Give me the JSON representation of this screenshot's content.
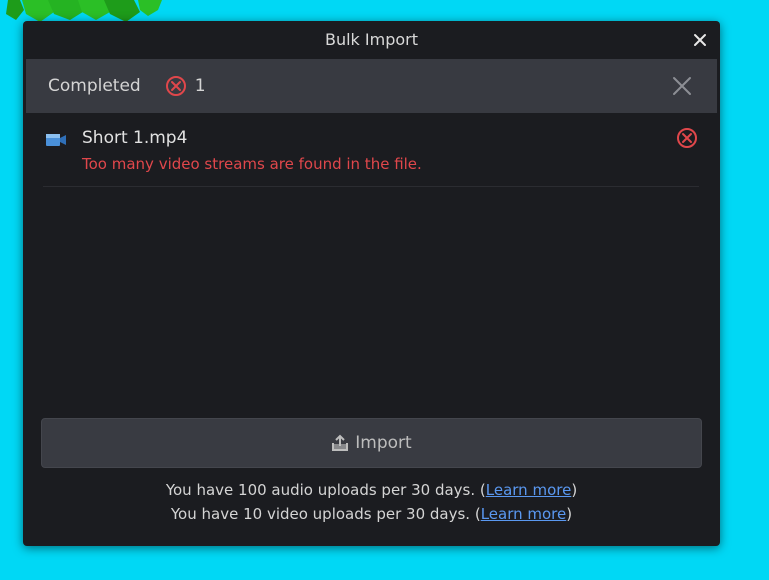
{
  "dialog": {
    "title": "Bulk Import"
  },
  "status": {
    "label": "Completed",
    "error_count": "1"
  },
  "files": [
    {
      "name": "Short 1.mp4",
      "error": "Too many video streams are found in the file."
    }
  ],
  "import_button": {
    "label": "Import"
  },
  "quota": {
    "audio_prefix": "You have 100 audio uploads per 30 days. (",
    "video_prefix": "You have 10 video uploads per 30 days. (",
    "link_label": "Learn more",
    "suffix": ")"
  },
  "colors": {
    "background": "#00d8f5",
    "dialog": "#1b1c20",
    "statusbar": "#383a41",
    "error": "#e0474b",
    "link": "#5a98f0"
  }
}
